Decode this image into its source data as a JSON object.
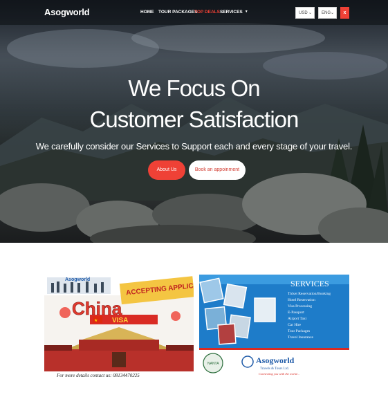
{
  "navbar": {
    "brand": "Asogworld",
    "links": [
      {
        "label": "HOME",
        "active": false
      },
      {
        "label": "TOUR PACKAGES",
        "active": false
      },
      {
        "label": "TOP DEALS",
        "active": true
      },
      {
        "label": "SERVICES",
        "active": false,
        "has_dropdown": true
      }
    ],
    "currency": "USD",
    "language": "ENG",
    "close_icon": "x"
  },
  "hero": {
    "headline_line1": "We Focus On",
    "headline_line2": "Customer Satisfaction",
    "subline": "We carefully consider our Services to Support each and every stage of your travel.",
    "primary_button": "About Us",
    "secondary_button": "Book an appoinment"
  },
  "promo_china": {
    "brand": "Asogworld",
    "ribbon": "ACCEPTING APPLICATIONS!",
    "title": "China",
    "subtitle": "VISA",
    "footer": "For more details contact us: 08134470225"
  },
  "promo_services": {
    "heading": "SERVICES",
    "items": [
      "Ticket Reservation/Booking",
      "Hotel Reservation",
      "Visa Processing",
      "E-Passport",
      "Airport Taxi",
      "Car Hire",
      "Tour Packages",
      "Travel Insurance"
    ],
    "brand": "Asogworld",
    "brand_sub": "Travels & Tours Ltd.",
    "tagline": "Connecting you with the world...",
    "seal": "NANTA"
  },
  "colors": {
    "accent": "#ef4136",
    "navbar_bg": "#0a0c10",
    "services_blue": "#1e7cc9"
  }
}
